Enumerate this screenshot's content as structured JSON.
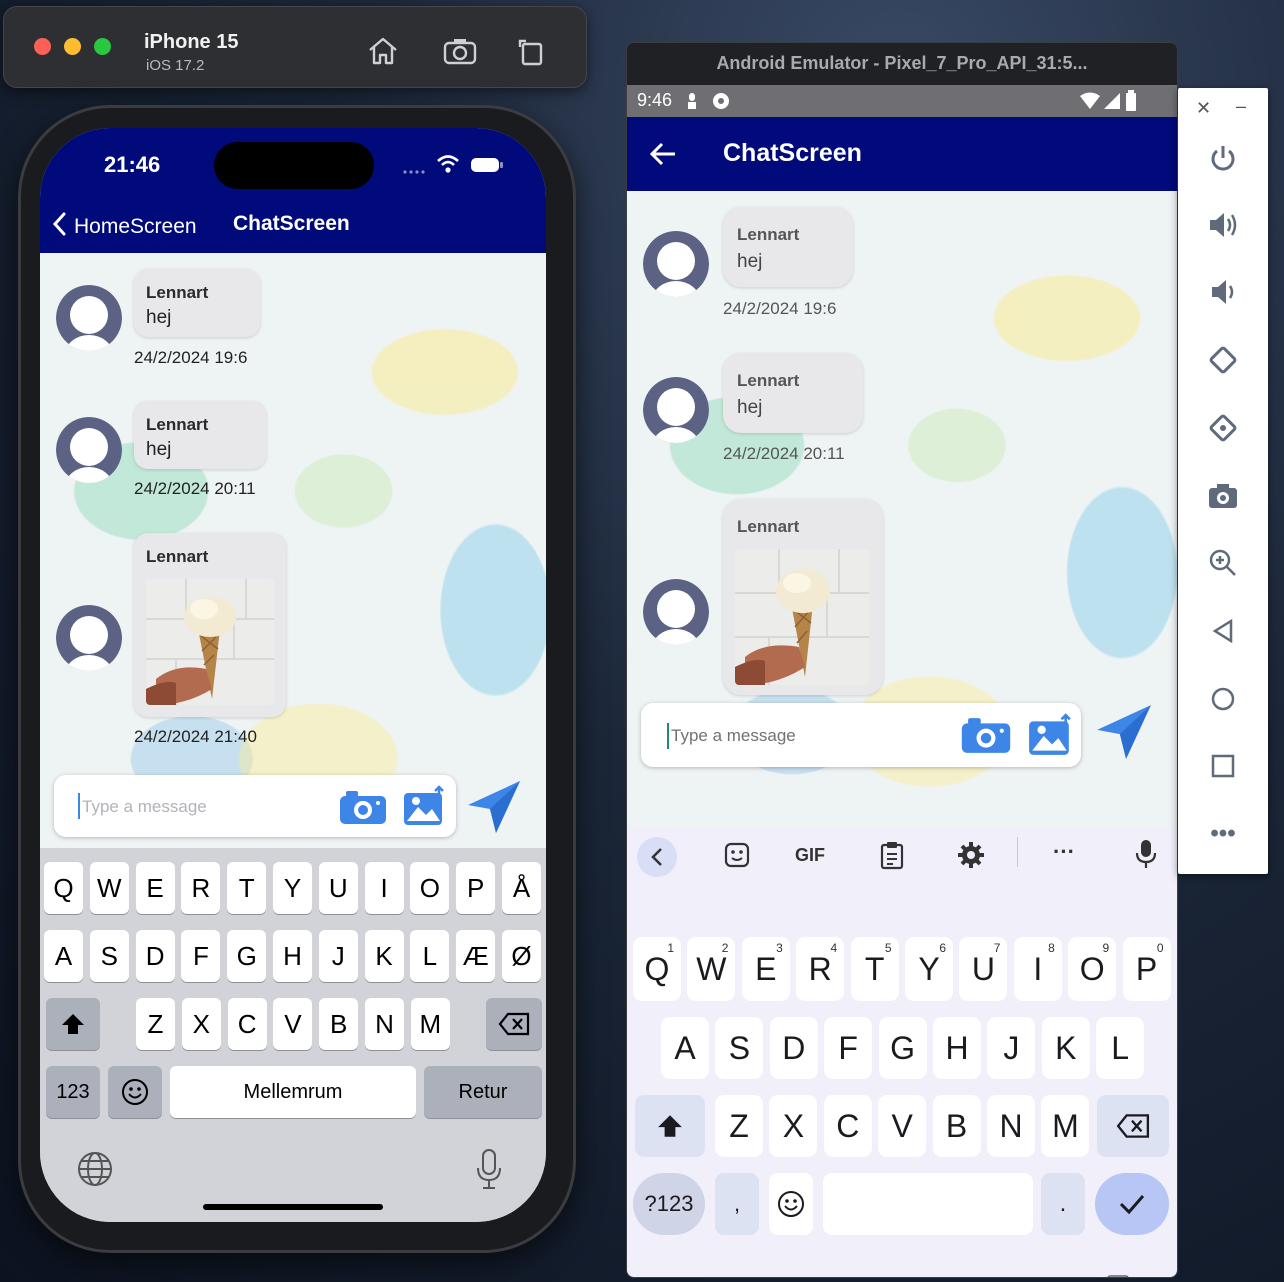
{
  "ios_sim": {
    "device": "iPhone 15",
    "os": "iOS 17.2",
    "status_time": "21:46",
    "nav": {
      "back_label": "HomeScreen",
      "title": "ChatScreen"
    },
    "messages": [
      {
        "sender": "Lennart",
        "text": "hej",
        "timestamp": "24/2/2024 19:6"
      },
      {
        "sender": "Lennart",
        "text": "hej",
        "timestamp": "24/2/2024 20:11"
      },
      {
        "sender": "Lennart",
        "image": "ice-cream-cone",
        "timestamp": "24/2/2024 21:40"
      }
    ],
    "input_placeholder": "Type a message",
    "keyboard": {
      "row1": [
        "Q",
        "W",
        "E",
        "R",
        "T",
        "Y",
        "U",
        "I",
        "O",
        "P",
        "Å"
      ],
      "row2": [
        "A",
        "S",
        "D",
        "F",
        "G",
        "H",
        "J",
        "K",
        "L",
        "Æ",
        "Ø"
      ],
      "row3": [
        "Z",
        "X",
        "C",
        "V",
        "B",
        "N",
        "M"
      ],
      "numbers_key": "123",
      "space_key": "Mellemrum",
      "return_key": "Retur"
    }
  },
  "android_emu": {
    "window_title": "Android Emulator - Pixel_7_Pro_API_31:5...",
    "status_time": "9:46",
    "appbar_title": "ChatScreen",
    "messages": [
      {
        "sender": "Lennart",
        "text": "hej",
        "timestamp": "24/2/2024 19:6"
      },
      {
        "sender": "Lennart",
        "text": "hej",
        "timestamp": "24/2/2024 20:11"
      },
      {
        "sender": "Lennart",
        "image": "ice-cream-cone"
      }
    ],
    "input_placeholder": "Type a message",
    "keyboard": {
      "toolbar": {
        "gif_label": "GIF",
        "more": "···"
      },
      "row1": [
        "Q",
        "W",
        "E",
        "R",
        "T",
        "Y",
        "U",
        "I",
        "O",
        "P"
      ],
      "row1_digits": [
        "1",
        "2",
        "3",
        "4",
        "5",
        "6",
        "7",
        "8",
        "9",
        "0"
      ],
      "row2": [
        "A",
        "S",
        "D",
        "F",
        "G",
        "H",
        "J",
        "K",
        "L"
      ],
      "row3": [
        "Z",
        "X",
        "C",
        "V",
        "B",
        "N",
        "M"
      ],
      "symbols_key": "?123",
      "comma_key": ",",
      "period_key": "."
    }
  },
  "colors": {
    "header_blue": "#010a7a",
    "accent_blue": "#3d86e8"
  }
}
